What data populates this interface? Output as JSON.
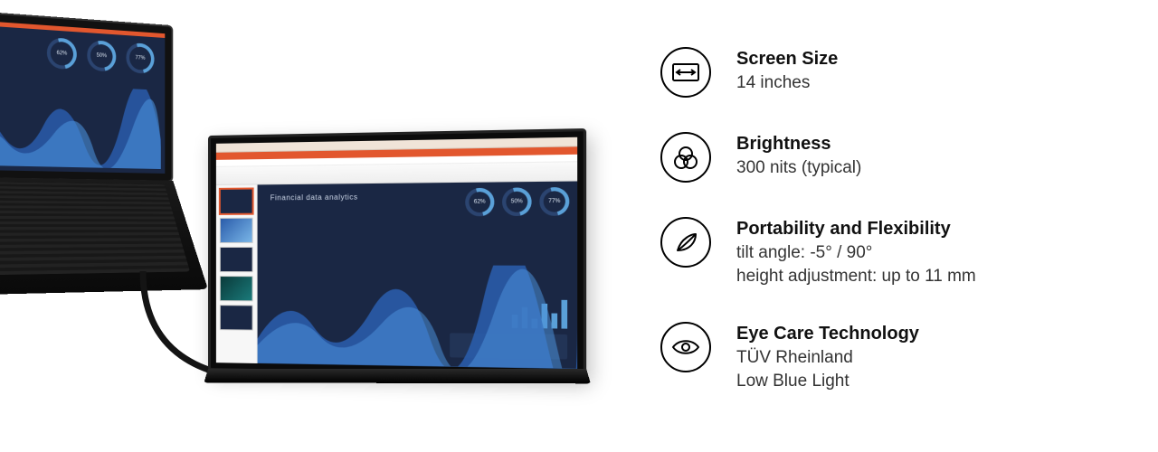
{
  "presentation": {
    "slide_title": "Financial data analytics",
    "donut_values": [
      "62%",
      "50%",
      "77%"
    ]
  },
  "specs": [
    {
      "icon": "screen-size-icon",
      "title": "Screen Size",
      "lines": [
        "14 inches"
      ]
    },
    {
      "icon": "brightness-icon",
      "title": "Brightness",
      "lines": [
        "300 nits (typical)"
      ]
    },
    {
      "icon": "portability-icon",
      "title": "Portability and Flexibility",
      "lines": [
        "tilt angle: -5° / 90°",
        "height adjustment: up to 11 mm"
      ]
    },
    {
      "icon": "eye-care-icon",
      "title": "Eye Care Technology",
      "lines": [
        "TÜV Rheinland",
        "Low Blue Light"
      ]
    }
  ]
}
